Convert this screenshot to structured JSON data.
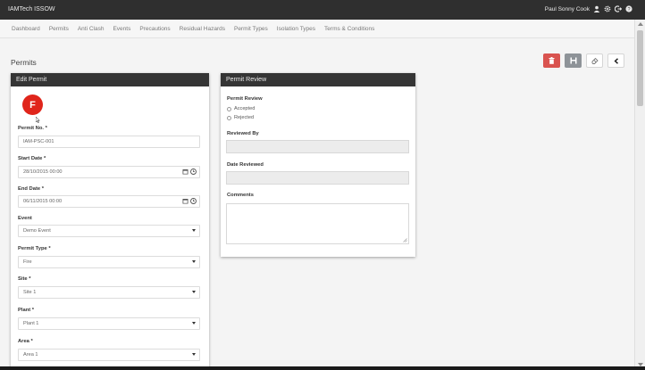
{
  "app": {
    "title": "IAMTech ISSOW",
    "user_name": "Paul Sonny Cook"
  },
  "nav": {
    "items": [
      "Dashboard",
      "Permits",
      "Anti Clash",
      "Events",
      "Precautions",
      "Residual Hazards",
      "Permit Types",
      "Isolation Types",
      "Terms & Conditions"
    ]
  },
  "page": {
    "title": "Permits"
  },
  "edit_panel": {
    "title": "Edit Permit",
    "avatar_letter": "F",
    "permit_no_label": "Permit No. *",
    "permit_no_value": "IAM-PSC-001",
    "start_date_label": "Start Date *",
    "start_date_value": "28/10/2015 00:00",
    "end_date_label": "End Date *",
    "end_date_value": "06/11/2015 00:00",
    "event_label": "Event",
    "event_value": "Demo Event",
    "permit_type_label": "Permit Type *",
    "permit_type_value": "Fire",
    "site_label": "Site *",
    "site_value": "Site 1",
    "plant_label": "Plant *",
    "plant_value": "Plant 1",
    "area_label": "Area *",
    "area_value": "Area 1"
  },
  "review_panel": {
    "title": "Permit Review",
    "permit_review_label": "Permit Review",
    "accepted_label": "Accepted",
    "rejected_label": "Rejected",
    "reviewed_by_label": "Reviewed By",
    "reviewed_by_value": "",
    "date_reviewed_label": "Date Reviewed",
    "date_reviewed_value": "",
    "comments_label": "Comments",
    "comments_value": ""
  },
  "colors": {
    "topbar": "#2f2f2f",
    "delete_button": "#d9534f",
    "save_button": "#8e9398",
    "avatar": "#e0251b",
    "panel_header": "#353535"
  },
  "icons": [
    "user-icon",
    "gear-icon",
    "logout-icon",
    "help-icon",
    "trash-icon",
    "save-icon",
    "eraser-icon",
    "chevron-left-icon",
    "calendar-icon",
    "clock-icon",
    "caret-down-icon"
  ]
}
